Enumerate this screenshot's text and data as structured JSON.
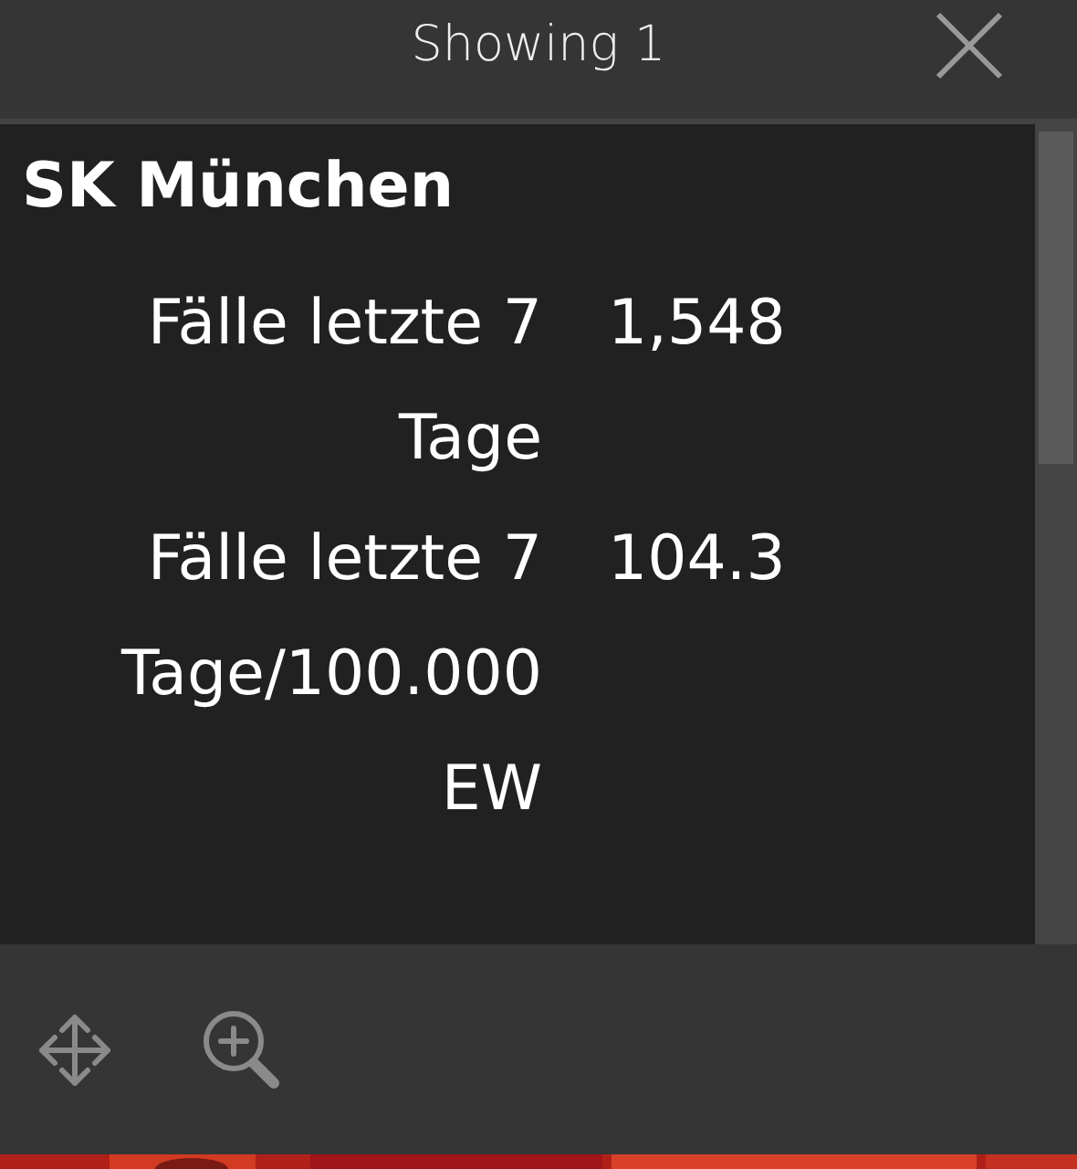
{
  "header": {
    "title": "Showing 1"
  },
  "feature": {
    "title": "SK München",
    "fields": [
      {
        "label": "Fälle letzte 7 Tage",
        "value": "1,548"
      },
      {
        "label": "Fälle letzte 7 Tage/100.000 EW",
        "value": "104.3"
      }
    ]
  },
  "footer": {
    "actions": [
      {
        "kind": "pan"
      },
      {
        "kind": "zoom"
      }
    ]
  }
}
